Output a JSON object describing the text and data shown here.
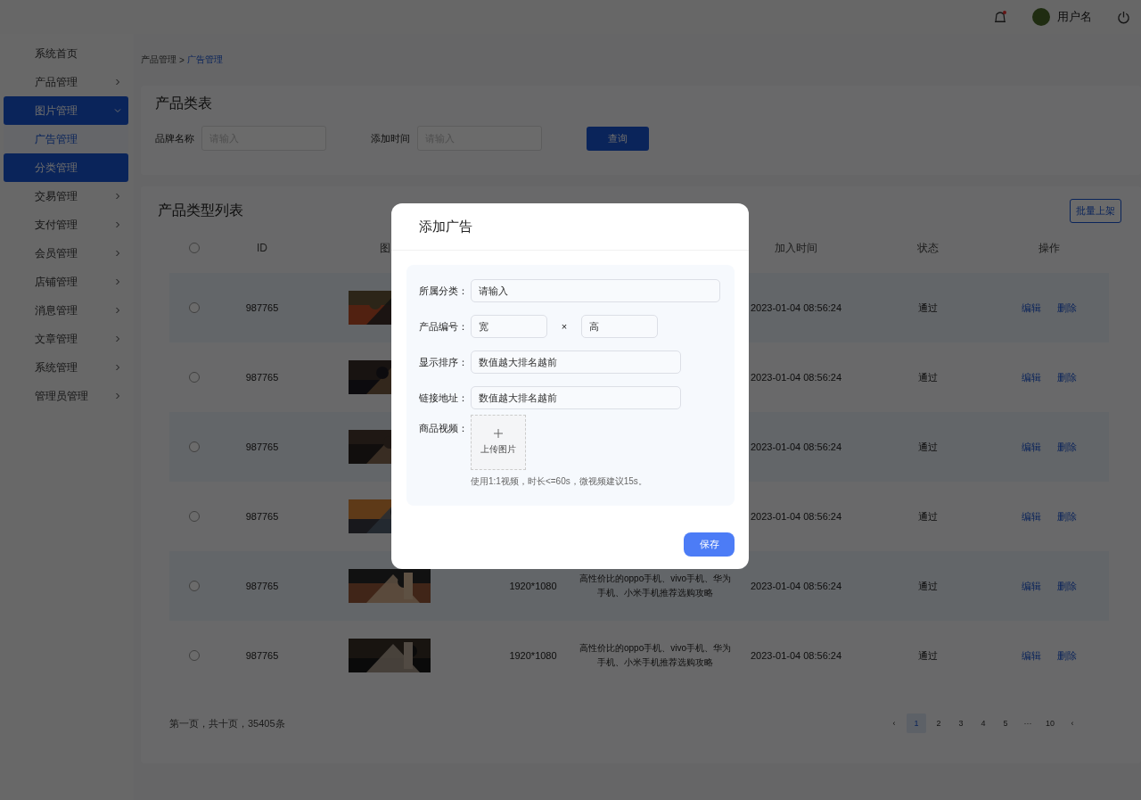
{
  "topbar": {
    "notification_unread": true,
    "username": "用户名"
  },
  "sidebar": {
    "items": [
      {
        "label": "系统首页",
        "has_children": false,
        "selected": false,
        "hovered": false
      },
      {
        "label": "产品管理",
        "has_children": true,
        "expanded": false,
        "selected": false,
        "hovered": false
      },
      {
        "label": "图片管理",
        "has_children": true,
        "expanded": true,
        "selected": true,
        "hovered": false,
        "children": [
          {
            "label": "广告管理",
            "selected": true,
            "hovered": false
          },
          {
            "label": "分类管理",
            "selected": false,
            "hovered": true
          }
        ]
      },
      {
        "label": "交易管理",
        "has_children": true,
        "expanded": false,
        "selected": false,
        "hovered": false
      },
      {
        "label": "支付管理",
        "has_children": true,
        "expanded": false,
        "selected": false,
        "hovered": false
      },
      {
        "label": "会员管理",
        "has_children": true,
        "expanded": false,
        "selected": false,
        "hovered": false
      },
      {
        "label": "店铺管理",
        "has_children": true,
        "expanded": false,
        "selected": false,
        "hovered": false
      },
      {
        "label": "消息管理",
        "has_children": true,
        "expanded": false,
        "selected": false,
        "hovered": false
      },
      {
        "label": "文章管理",
        "has_children": true,
        "expanded": false,
        "selected": false,
        "hovered": false
      },
      {
        "label": "系统管理",
        "has_children": true,
        "expanded": false,
        "selected": false,
        "hovered": false
      },
      {
        "label": "管理员管理",
        "has_children": true,
        "expanded": false,
        "selected": false,
        "hovered": false
      }
    ]
  },
  "breadcrumb": [
    "产品管理",
    "广告管理"
  ],
  "breadcrumb_separator": ">",
  "filter": {
    "title": "产品类表",
    "fields": [
      {
        "label": "品牌名称",
        "placeholder": "请输入"
      },
      {
        "label": "添加时间",
        "placeholder": "请输入"
      }
    ],
    "button": "查询"
  },
  "table": {
    "title": "产品类型列表",
    "batch_button": "批量上架",
    "select_all_checked": false,
    "columns": {
      "id": "ID",
      "image": "图",
      "time": "加入时间",
      "status": "状态",
      "actions": "操作"
    },
    "rows": [
      {
        "checked": false,
        "id": "987765",
        "time": "2023-01-04 08:56:24",
        "status": "通过",
        "actions": [
          "编辑",
          "删除"
        ]
      },
      {
        "checked": false,
        "id": "987765",
        "time": "2023-01-04 08:56:24",
        "status": "通过",
        "actions": [
          "编辑",
          "删除"
        ]
      },
      {
        "checked": false,
        "id": "987765",
        "time": "2023-01-04 08:56:24",
        "status": "通过",
        "actions": [
          "编辑",
          "删除"
        ]
      },
      {
        "checked": false,
        "id": "987765",
        "time": "2023-01-04 08:56:24",
        "status": "通过",
        "actions": [
          "编辑",
          "删除"
        ]
      },
      {
        "checked": false,
        "id": "987765",
        "size": "1920*1080",
        "description": "高性价比的oppo手机、vivo手机、华为手机、小米手机推荐选购攻略",
        "time": "2023-01-04 08:56:24",
        "status": "通过",
        "actions": [
          "编辑",
          "删除"
        ]
      },
      {
        "checked": false,
        "id": "987765",
        "size": "1920*1080",
        "description": "高性价比的oppo手机、vivo手机、华为手机、小米手机推荐选购攻略",
        "time": "2023-01-04 08:56:24",
        "status": "通过",
        "actions": [
          "编辑",
          "删除"
        ]
      }
    ]
  },
  "pagination": {
    "summary": "第一页，共十页，35405条",
    "prev": "‹",
    "pages": [
      {
        "label": "1",
        "selected": true
      },
      {
        "label": "2",
        "selected": false
      },
      {
        "label": "3",
        "selected": false
      },
      {
        "label": "4",
        "selected": false
      },
      {
        "label": "5",
        "selected": false
      },
      {
        "label": "···",
        "selected": false
      },
      {
        "label": "10",
        "selected": false
      }
    ],
    "next": "‹"
  },
  "dialog": {
    "title": "添加广告",
    "fields": [
      {
        "kind": "select",
        "label": "所属分类：",
        "value": "请输入"
      },
      {
        "kind": "size",
        "label": "产品编号：",
        "values": [
          "宽",
          "高"
        ],
        "separator": "×"
      },
      {
        "kind": "text",
        "label": "显示排序：",
        "value": "数值越大排名越前"
      },
      {
        "kind": "text",
        "label": "链接地址：",
        "value": "数值越大排名越前"
      },
      {
        "kind": "upload",
        "label": "商品视频：",
        "button": "上传图片",
        "hint": "使用1:1视频，时长<=60s，微视频建议15s。"
      }
    ],
    "save": "保存"
  }
}
